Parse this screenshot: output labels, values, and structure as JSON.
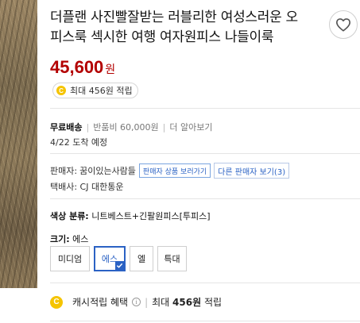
{
  "product": {
    "title_line1": "더플랜 사진빨잘받는 러블리한 여성스러운 오",
    "title_line2": "피스룩 섹시한 여행 여자원피스 나들이룩",
    "price": "45,600",
    "price_unit": "원",
    "cash_badge": {
      "coin": "C",
      "label": "최대 456원 적립"
    }
  },
  "shipping": {
    "label": "무료배송",
    "return_fee": "반품비 60,000원",
    "more": "더 알아보기",
    "delivery": "4/22 도착 예정"
  },
  "seller": {
    "label": "판매자:",
    "name": "꿈이있는사람들",
    "goods_button": "판매자 상품 보러가기",
    "other_sellers_button": "다른 판매자 보기(3)",
    "courier": "택배사: CJ 대한통운"
  },
  "color": {
    "label": "색상 분류:",
    "value": "니트베스트+긴팔원피스[투피스]"
  },
  "size": {
    "label": "크기:",
    "selected": "에스",
    "options": [
      {
        "label": "미디엄",
        "selected": false
      },
      {
        "label": "에스",
        "selected": true
      },
      {
        "label": "엘",
        "selected": false
      },
      {
        "label": "특대",
        "selected": false
      }
    ]
  },
  "cash_benefit": {
    "coin": "C",
    "label": "캐시적립 혜택",
    "info": "i",
    "prefix": "최대",
    "amount": "456원",
    "suffix": "적립"
  },
  "colors": {
    "price_red": "#b30000",
    "accent_blue": "#2b62c4",
    "coin_yellow": "#f5c400"
  },
  "icons": {
    "wishlist": "heart-icon",
    "check": "check-icon",
    "info": "info-icon",
    "coin": "coin-icon"
  }
}
